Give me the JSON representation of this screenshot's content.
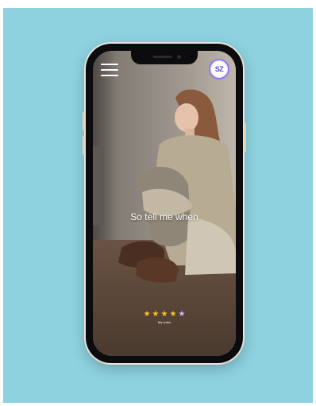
{
  "logo": {
    "text": "SZ"
  },
  "video": {
    "caption": "So tell me when"
  },
  "rating": {
    "value": 4,
    "max": 5,
    "label": "My votes",
    "star_color": "#f4c52d",
    "empty_star_color": "#c9bdf3"
  },
  "colors": {
    "background": "#8ed1df",
    "phone_frame": "#0c0c0e"
  },
  "icons": {
    "menu": "hamburger-menu-icon",
    "logo": "sz-logo-icon"
  }
}
